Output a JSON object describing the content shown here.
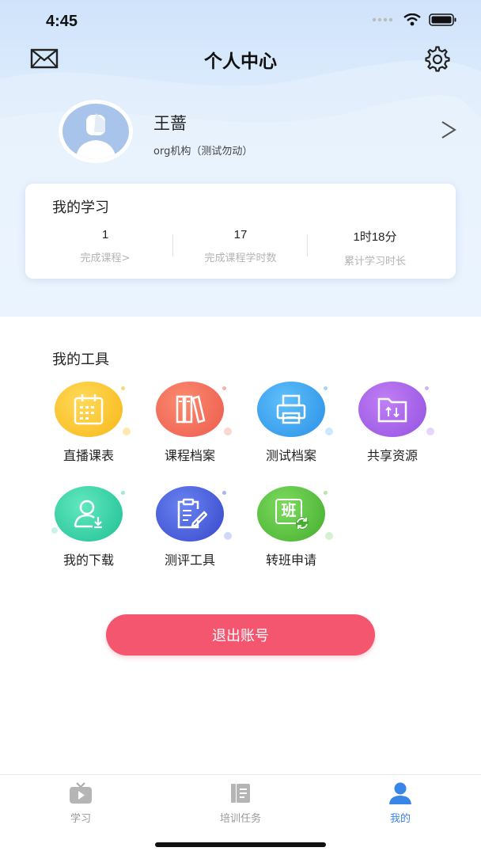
{
  "status": {
    "time": "4:45"
  },
  "nav": {
    "title": "个人中心",
    "mail_icon": "mail-icon",
    "settings_icon": "gear-icon"
  },
  "profile": {
    "name": "王蔷",
    "org": "org机构（测试勿动）",
    "arrow": ">"
  },
  "study": {
    "title": "我的学习",
    "stats": [
      {
        "value": "1",
        "label": "完成课程>"
      },
      {
        "value": "17",
        "label": "完成课程学时数"
      },
      {
        "value": "1时18分",
        "label": "累计学习时长"
      }
    ]
  },
  "tools": {
    "title": "我的工具",
    "items": [
      {
        "label": "直播课表",
        "icon": "calendar-icon",
        "color": "#f7c325"
      },
      {
        "label": "课程档案",
        "icon": "books-icon",
        "color": "#f06a55"
      },
      {
        "label": "测试档案",
        "icon": "printer-icon",
        "color": "#3aa3ef"
      },
      {
        "label": "共享资源",
        "icon": "folder-icon",
        "color": "#a463e6"
      },
      {
        "label": "我的下载",
        "icon": "user-download-icon",
        "color": "#32d4a8"
      },
      {
        "label": "测评工具",
        "icon": "clipboard-icon",
        "color": "#4a63e0"
      },
      {
        "label": "转班申请",
        "icon": "class-transfer-icon",
        "color": "#5cc63f",
        "glyph": "班"
      }
    ]
  },
  "logout": {
    "label": "退出账号",
    "color": "#f4566f"
  },
  "tabbar": {
    "items": [
      {
        "label": "学习",
        "icon": "tv-icon"
      },
      {
        "label": "培训任务",
        "icon": "task-book-icon"
      },
      {
        "label": "我的",
        "icon": "person-icon"
      }
    ],
    "active": "我的",
    "active_color": "#3a86e8"
  }
}
